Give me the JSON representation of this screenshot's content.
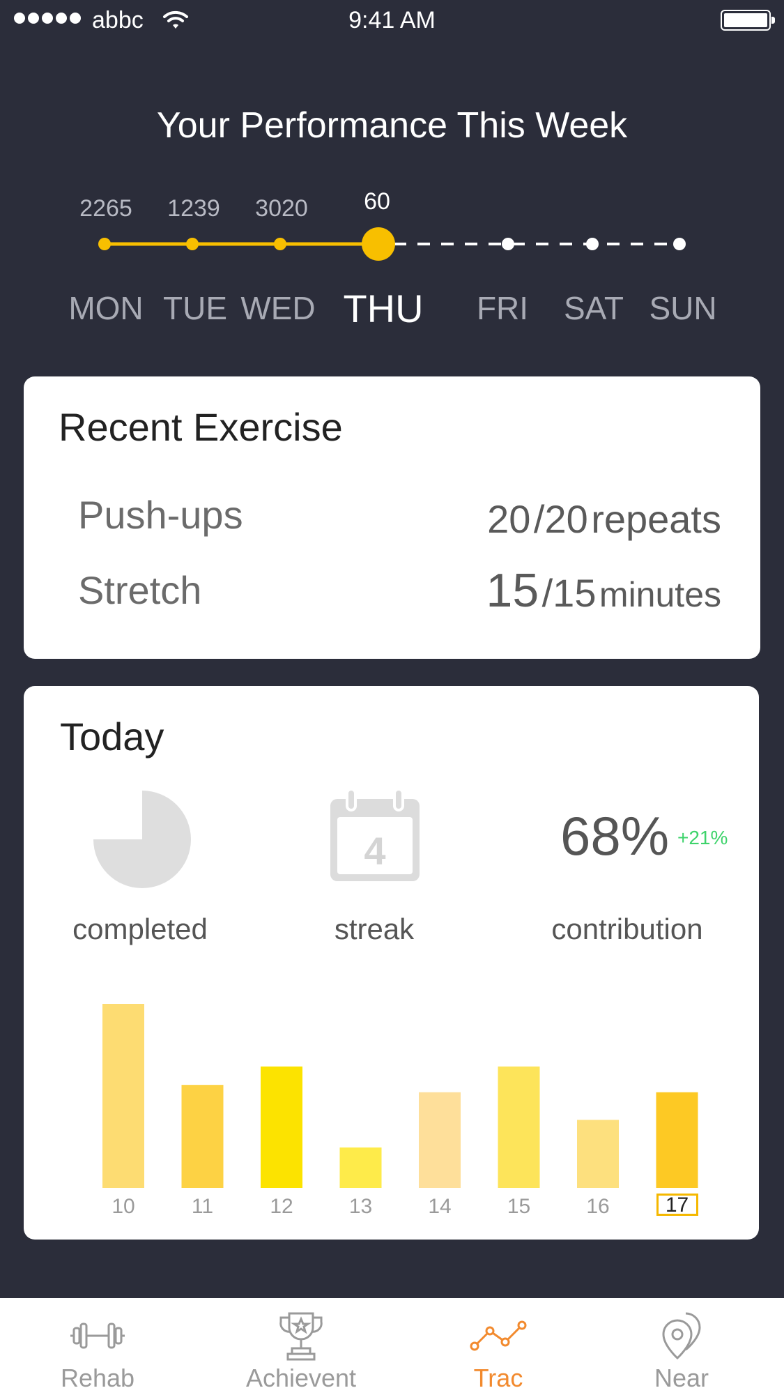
{
  "status_bar": {
    "carrier": "abbc",
    "time": "9:41 AM"
  },
  "week": {
    "title": "Your Performance This Week",
    "days": [
      {
        "label": "MON",
        "value": "2265",
        "state": "done"
      },
      {
        "label": "TUE",
        "value": "1239",
        "state": "done"
      },
      {
        "label": "WED",
        "value": "3020",
        "state": "done"
      },
      {
        "label": "THU",
        "value": "60",
        "state": "current"
      },
      {
        "label": "FRI",
        "value": "",
        "state": "upcoming"
      },
      {
        "label": "SAT",
        "value": "",
        "state": "upcoming"
      },
      {
        "label": "SUN",
        "value": "",
        "state": "upcoming"
      }
    ],
    "accent_color": "#f8bf00"
  },
  "recent": {
    "title": "Recent Exercise",
    "items": [
      {
        "name": "Push-ups",
        "count": "20",
        "target": "/20",
        "unit": "repeats"
      },
      {
        "name": "Stretch",
        "count": "15",
        "target": "/15",
        "unit": "minutes"
      }
    ]
  },
  "today": {
    "title": "Today",
    "completed_label": "completed",
    "completed_fraction": 0.75,
    "streak_label": "streak",
    "streak_value": "4",
    "contribution_value": "68%",
    "contribution_delta": "+21%",
    "contribution_label": "contribution",
    "delta_color": "#3ed36b"
  },
  "chart_data": {
    "type": "bar",
    "categories": [
      "10",
      "11",
      "12",
      "13",
      "14",
      "15",
      "16",
      "17"
    ],
    "values": [
      100,
      56,
      66,
      22,
      52,
      66,
      37,
      52
    ],
    "colors": [
      "#fddc72",
      "#fdd244",
      "#fce300",
      "#feeb4a",
      "#fedf9a",
      "#fde45a",
      "#fde07e",
      "#fdc924"
    ],
    "highlighted": "17",
    "ylim": [
      0,
      100
    ]
  },
  "tabs": [
    {
      "label": "Rehab",
      "icon": "dumbbell-icon",
      "active": false
    },
    {
      "label": "Achievent",
      "icon": "trophy-icon",
      "active": false
    },
    {
      "label": "Trac",
      "icon": "trend-line-icon",
      "active": true
    },
    {
      "label": "Near",
      "icon": "map-pin-icon",
      "active": false
    }
  ]
}
